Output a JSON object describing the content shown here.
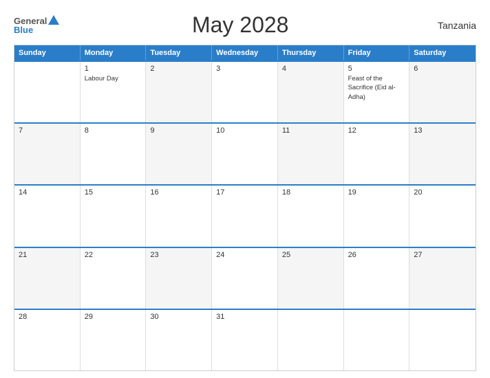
{
  "header": {
    "title": "May 2028",
    "country": "Tanzania",
    "logo": {
      "general": "General",
      "blue": "Blue"
    }
  },
  "calendar": {
    "days_of_week": [
      "Sunday",
      "Monday",
      "Tuesday",
      "Wednesday",
      "Thursday",
      "Friday",
      "Saturday"
    ],
    "weeks": [
      [
        {
          "day": "",
          "events": [],
          "alt": false
        },
        {
          "day": "1",
          "events": [
            "Labour Day"
          ],
          "alt": false
        },
        {
          "day": "2",
          "events": [],
          "alt": false
        },
        {
          "day": "3",
          "events": [],
          "alt": false
        },
        {
          "day": "4",
          "events": [],
          "alt": false
        },
        {
          "day": "5",
          "events": [
            "Feast of the Sacrifice (Eid al-Adha)"
          ],
          "alt": false
        },
        {
          "day": "6",
          "events": [],
          "alt": false
        }
      ],
      [
        {
          "day": "7",
          "events": [],
          "alt": true
        },
        {
          "day": "8",
          "events": [],
          "alt": false
        },
        {
          "day": "9",
          "events": [],
          "alt": true
        },
        {
          "day": "10",
          "events": [],
          "alt": false
        },
        {
          "day": "11",
          "events": [],
          "alt": true
        },
        {
          "day": "12",
          "events": [],
          "alt": false
        },
        {
          "day": "13",
          "events": [],
          "alt": true
        }
      ],
      [
        {
          "day": "14",
          "events": [],
          "alt": false
        },
        {
          "day": "15",
          "events": [],
          "alt": false
        },
        {
          "day": "16",
          "events": [],
          "alt": false
        },
        {
          "day": "17",
          "events": [],
          "alt": false
        },
        {
          "day": "18",
          "events": [],
          "alt": false
        },
        {
          "day": "19",
          "events": [],
          "alt": false
        },
        {
          "day": "20",
          "events": [],
          "alt": false
        }
      ],
      [
        {
          "day": "21",
          "events": [],
          "alt": true
        },
        {
          "day": "22",
          "events": [],
          "alt": false
        },
        {
          "day": "23",
          "events": [],
          "alt": true
        },
        {
          "day": "24",
          "events": [],
          "alt": false
        },
        {
          "day": "25",
          "events": [],
          "alt": true
        },
        {
          "day": "26",
          "events": [],
          "alt": false
        },
        {
          "day": "27",
          "events": [],
          "alt": true
        }
      ],
      [
        {
          "day": "28",
          "events": [],
          "alt": false
        },
        {
          "day": "29",
          "events": [],
          "alt": false
        },
        {
          "day": "30",
          "events": [],
          "alt": false
        },
        {
          "day": "31",
          "events": [],
          "alt": false
        },
        {
          "day": "",
          "events": [],
          "alt": false
        },
        {
          "day": "",
          "events": [],
          "alt": false
        },
        {
          "day": "",
          "events": [],
          "alt": false
        }
      ]
    ]
  }
}
